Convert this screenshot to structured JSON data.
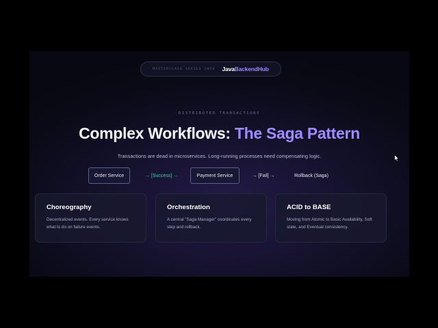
{
  "header": {
    "series_label": "MASTERCLASS SERIES 2026",
    "brand_primary": "Java",
    "brand_secondary": "BackendHub"
  },
  "eyebrow": "DISTRIBUTED TRANSACTIONS",
  "title": {
    "main": "Complex Workflows:",
    "accent": "The Saga Pattern"
  },
  "subtitle": "Transactions are dead in microservices. Long-running processes need compensating logic.",
  "flow": {
    "step1": "Order Service",
    "arrow1": "→ [Success] →",
    "step2": "Payment Service",
    "arrow2": "→ [Fail] →",
    "step3": "Rollback (Saga)"
  },
  "cards": [
    {
      "title": "Choreography",
      "text": "Decentralized events. Every service knows what to do on failure events."
    },
    {
      "title": "Orchestration",
      "text": "A central \"Saga Manager\" coordinates every step and rollback."
    },
    {
      "title": "ACID to BASE",
      "text": "Moving from Atomic to Basic Availability, Soft state, and Eventual consistency."
    }
  ],
  "colors": {
    "accent": "#a08aff",
    "success": "#3ecf9a",
    "background": "#0a0a16"
  },
  "icons": {
    "cursor": "mouse-pointer-icon"
  }
}
